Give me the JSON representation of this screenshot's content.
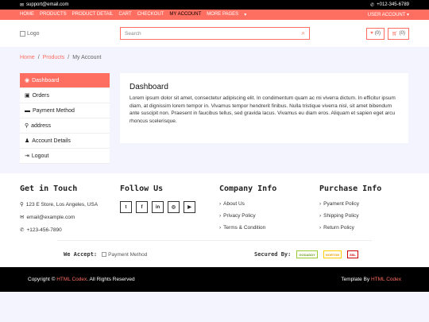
{
  "topbar": {
    "email": "support@email.com",
    "phone": "+012-345-6789"
  },
  "nav": {
    "links": [
      "HOME",
      "PRODUCTS",
      "PRODUCT DETAIL",
      "CART",
      "CHECKOUT",
      "MY ACCOUNT",
      "MORE PAGES"
    ],
    "active_index": 5,
    "user_account": "USER ACCOUNT"
  },
  "header": {
    "logo_alt": "Logo",
    "search_placeholder": "Search",
    "wishlist_count": "(0)",
    "cart_count": "(0)"
  },
  "breadcrumb": [
    "Home",
    "Products",
    "My Account"
  ],
  "sidebar": {
    "items": [
      {
        "label": "Dashboard",
        "icon": "tachometer-icon",
        "glyph": "◉"
      },
      {
        "label": "Orders",
        "icon": "shopping-bag-icon",
        "glyph": "▣"
      },
      {
        "label": "Payment Method",
        "icon": "credit-card-icon",
        "glyph": "▬"
      },
      {
        "label": "address",
        "icon": "map-marker-icon",
        "glyph": "⚲"
      },
      {
        "label": "Account Details",
        "icon": "user-icon",
        "glyph": "♟"
      },
      {
        "label": "Logout",
        "icon": "sign-out-icon",
        "glyph": "⇥"
      }
    ],
    "active_index": 0,
    "accent": "#ff6f61"
  },
  "content": {
    "title": "Dashboard",
    "body": "Lorem ipsum dolor sit amet, consectetur adipiscing elit. In condimentum quam ac mi viverra dictum. In efficitur ipsum diam, at dignissim lorem tempor in. Vivamus tempor hendrerit finibus. Nulla tristique viverra nisl, sit amet bibendum ante suscipit non. Praesent in faucibus tellus, sed gravida lacus. Vivamus eu diam eros. Aliquam et sapien eget arcu rhoncus scelerisque."
  },
  "footer": {
    "touch": {
      "title": "Get in Touch",
      "address": "123 E Store, Los Angeles, USA",
      "email": "email@example.com",
      "phone": "+123-456-7890"
    },
    "follow": {
      "title": "Follow Us",
      "icons": [
        "twitter-icon",
        "facebook-icon",
        "linkedin-icon",
        "instagram-icon",
        "youtube-icon"
      ],
      "glyphs": [
        "t",
        "f",
        "in",
        "◎",
        "▶"
      ]
    },
    "company": {
      "title": "Company Info",
      "links": [
        "About Us",
        "Privacy Policy",
        "Terms & Condition"
      ]
    },
    "purchase": {
      "title": "Purchase Info",
      "links": [
        "Pyament Policy",
        "Shipping Policy",
        "Return Policy"
      ]
    },
    "we_accept": "We Accept:",
    "payment_alt": "Payment Method",
    "secured_by": "Secured By:",
    "badges": [
      "GODADDY",
      "NORTON",
      "SSL"
    ]
  },
  "bottom": {
    "copyright_prefix": "Copyright © ",
    "copyright_brand": "HTML Codex",
    "copyright_suffix": ". All Rights Reserved",
    "template_prefix": "Template By ",
    "template_brand": "HTML Codex"
  }
}
